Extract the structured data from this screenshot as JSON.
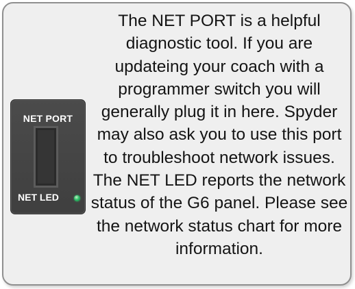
{
  "panel": {
    "port_label": "NET PORT",
    "led_label": "NET LED",
    "led_color": "#2fc06a",
    "panel_color": "#454545"
  },
  "description": {
    "text": "The NET PORT is a helpful diagnostic tool. If you are updateing your coach with a programmer switch you will generally plug it in here. Spyder may also ask you to use this port to troubleshoot network issues. The NET LED reports the network status of the G6 panel. Please see the network status chart for more information."
  }
}
